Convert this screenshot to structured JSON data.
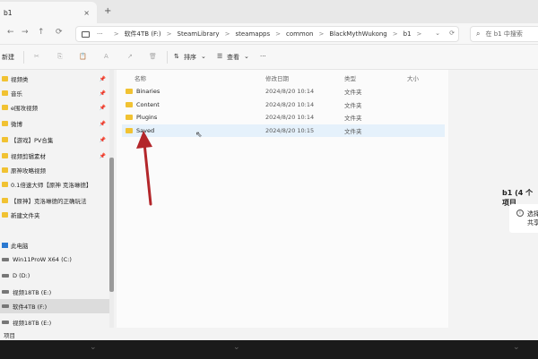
{
  "tab": {
    "title": "b1",
    "close": "×",
    "add": "+"
  },
  "nav": {
    "back": "←",
    "forward": "→",
    "up": "↑",
    "refresh": "⟳"
  },
  "breadcrumb": {
    "dots": "···",
    "items": [
      "软件4TB (F:)",
      "SteamLibrary",
      "steamapps",
      "common",
      "BlackMythWukong",
      "b1"
    ],
    "sep": ">",
    "dropdown": "⌄",
    "refresh": "⟳"
  },
  "search": {
    "placeholder": "在 b1 中搜索"
  },
  "commands": {
    "new": "新建",
    "sort": "排序",
    "view": "查看",
    "more": "···",
    "cut_icon": "✂",
    "copy_icon": "⎘",
    "paste_icon": "📋",
    "rename_icon": "A",
    "share_icon": "↗",
    "delete_icon": "🗑"
  },
  "columns": {
    "name": "名称",
    "date": "修改日期",
    "type": "类型",
    "size": "大小"
  },
  "files": [
    {
      "name": "Binaries",
      "date": "2024/8/20 10:14",
      "type": "文件夹"
    },
    {
      "name": "Content",
      "date": "2024/8/20 10:14",
      "type": "文件夹"
    },
    {
      "name": "Plugins",
      "date": "2024/8/20 10:14",
      "type": "文件夹"
    },
    {
      "name": "Saved",
      "date": "2024/8/20 10:15",
      "type": "文件夹"
    }
  ],
  "sidebar": {
    "pin": "📌",
    "items": [
      {
        "label": "视频类",
        "kind": "folder",
        "pinned": true
      },
      {
        "label": "音乐",
        "kind": "folder",
        "pinned": true
      },
      {
        "label": "e围攻视频",
        "kind": "folder",
        "pinned": true
      },
      {
        "label": "微博",
        "kind": "folder",
        "pinned": true
      },
      {
        "label": "【游戏】PV合集",
        "kind": "folder",
        "pinned": true
      },
      {
        "label": "视频剪辑素材",
        "kind": "folder",
        "pinned": true
      },
      {
        "label": "原神攻略视频",
        "kind": "folder",
        "pinned": false
      },
      {
        "label": "0.1倍速大师【原神 克洛琳德】",
        "kind": "folder",
        "pinned": false
      },
      {
        "label": "【原神】克洛琳德的正确玩法",
        "kind": "folder",
        "pinned": false
      },
      {
        "label": "新建文件夹",
        "kind": "folder",
        "pinned": false
      },
      {
        "label": "此电脑",
        "kind": "pc",
        "pinned": false
      },
      {
        "label": "Win11ProW X64 (C:)",
        "kind": "drive",
        "pinned": false
      },
      {
        "label": "D (D:)",
        "kind": "drive",
        "pinned": false
      },
      {
        "label": "视频18TB (E:)",
        "kind": "drive",
        "pinned": false
      },
      {
        "label": "软件4TB (F:)",
        "kind": "drive",
        "pinned": false
      },
      {
        "label": "视频18TB (E:)",
        "kind": "drive",
        "pinned": false
      }
    ]
  },
  "details": {
    "title": "b1 (4 个项目",
    "info_icon": "i",
    "line1": "选择单",
    "line2": "共享文"
  },
  "status": {
    "text": "项目"
  },
  "colors": {
    "folder": "#f1c232",
    "arrow": "#b3262a",
    "selection": "#e5f1fb"
  }
}
